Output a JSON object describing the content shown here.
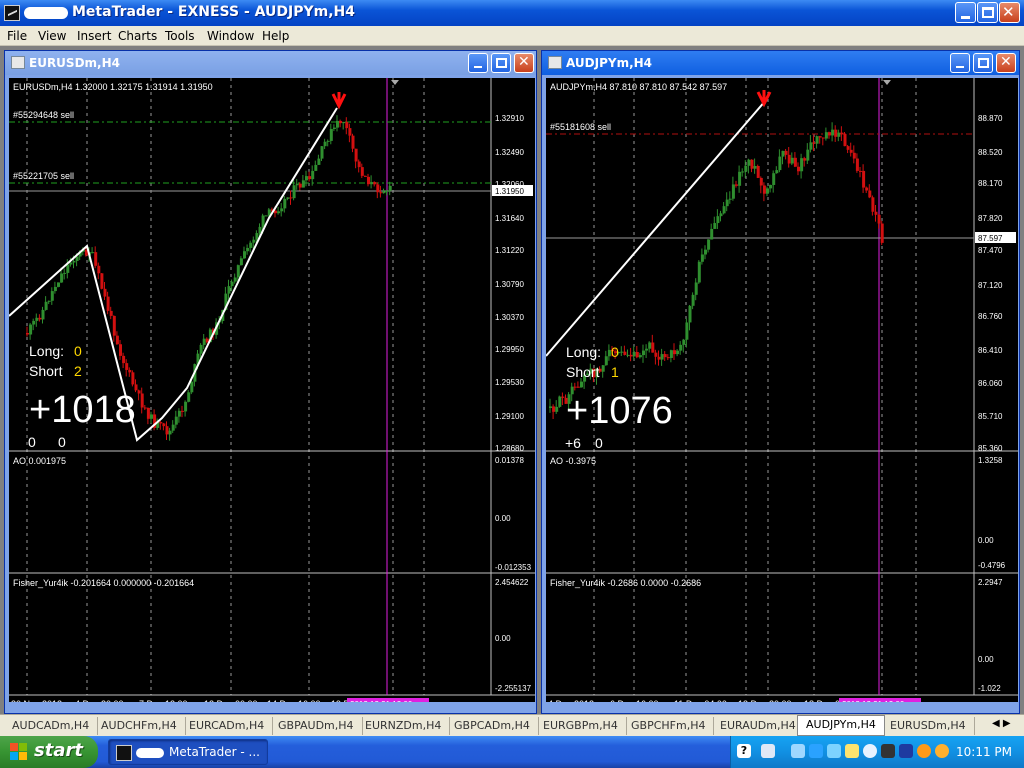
{
  "window": {
    "title": "MetaTrader - EXNESS - AUDJPYm,H4"
  },
  "menu": [
    "File",
    "View",
    "Insert",
    "Charts",
    "Tools",
    "Window",
    "Help"
  ],
  "charts": [
    {
      "title": "EURUSDm,H4",
      "info": "EURUSDm,H4  1.32000 1.32175 1.31914 1.31950",
      "orders": [
        "#55294648 sell",
        "#55221705 sell"
      ],
      "price_labels": [
        "1.32910",
        "1.32490",
        "1.32060",
        "1.31950",
        "1.31640",
        "1.31220",
        "1.30790",
        "1.30370",
        "1.29950",
        "1.29530",
        "1.29100",
        "1.28680"
      ],
      "current_price": "1.31950",
      "long_label": "Long:",
      "long_value": "0",
      "short_label": "Short",
      "short_value": "2",
      "profit": "+1018",
      "small_left": "0",
      "small_right": "0",
      "ao_label": "AO 0.001975",
      "ao_scale": [
        "0.01378",
        "0.00",
        "-0.012353"
      ],
      "fisher_label": "Fisher_Yur4ik -0.201664 0.000000 -0.201664",
      "fisher_scale": [
        "2.454622",
        "0.00",
        "-2.255137"
      ],
      "dates": [
        "30 Nov 2012",
        "4 Dec 20:00",
        "7 Dec 12:00",
        "12 Dec 00:00",
        "14 Dec 16:00",
        "19 D"
      ],
      "marker_date": "2012.12.21 12:00"
    },
    {
      "title": "AUDJPYm,H4",
      "info": "AUDJPYm,H4  87.810 87.810 87.542 87.597",
      "orders": [
        "#55181608 sell"
      ],
      "price_labels": [
        "88.870",
        "88.520",
        "88.170",
        "87.820",
        "87.597",
        "87.470",
        "87.120",
        "86.760",
        "86.410",
        "86.060",
        "85.710",
        "85.360"
      ],
      "current_price": "87.597",
      "long_label": "Long:",
      "long_value": "0",
      "short_label": "Short",
      "short_value": "1",
      "profit": "+1076",
      "small_left": "+6",
      "small_right": "0",
      "ao_label": "AO -0.3975",
      "ao_scale": [
        "1.3258",
        "0.00",
        "-0.4796"
      ],
      "fisher_label": "Fisher_Yur4ik -0.2686 0.0000 -0.2686",
      "fisher_scale": [
        "2.2947",
        "0.00",
        "-1.022"
      ],
      "dates": [
        "4 Dec 2012",
        "6 Dec 16:00",
        "11 Dec 04:00",
        "13 Dec 20:00",
        "18 Dec 0"
      ],
      "marker_date": "2012.12.21 12:00"
    }
  ],
  "tabs": [
    "AUDCADm,H4",
    "AUDCHFm,H4",
    "EURCADm,H4",
    "GBPAUDm,H4",
    "EURNZDm,H4",
    "GBPCADm,H4",
    "EURGBPm,H4",
    "GBPCHFm,H4",
    "EURAUDm,H4",
    "AUDJPYm,H4",
    "EURUSDm,H4"
  ],
  "active_tab": "AUDJPYm,H4",
  "taskbar": {
    "start": "start",
    "task": "MetaTrader - ...",
    "clock": "10:11 PM"
  },
  "colors": {
    "bull": "#2f8f2f",
    "bear": "#d21010",
    "sell_line_green": "#1fa11f",
    "sell_line_red": "#b01010",
    "marker": "#e020e0",
    "title_active": "#0f5fe0"
  }
}
